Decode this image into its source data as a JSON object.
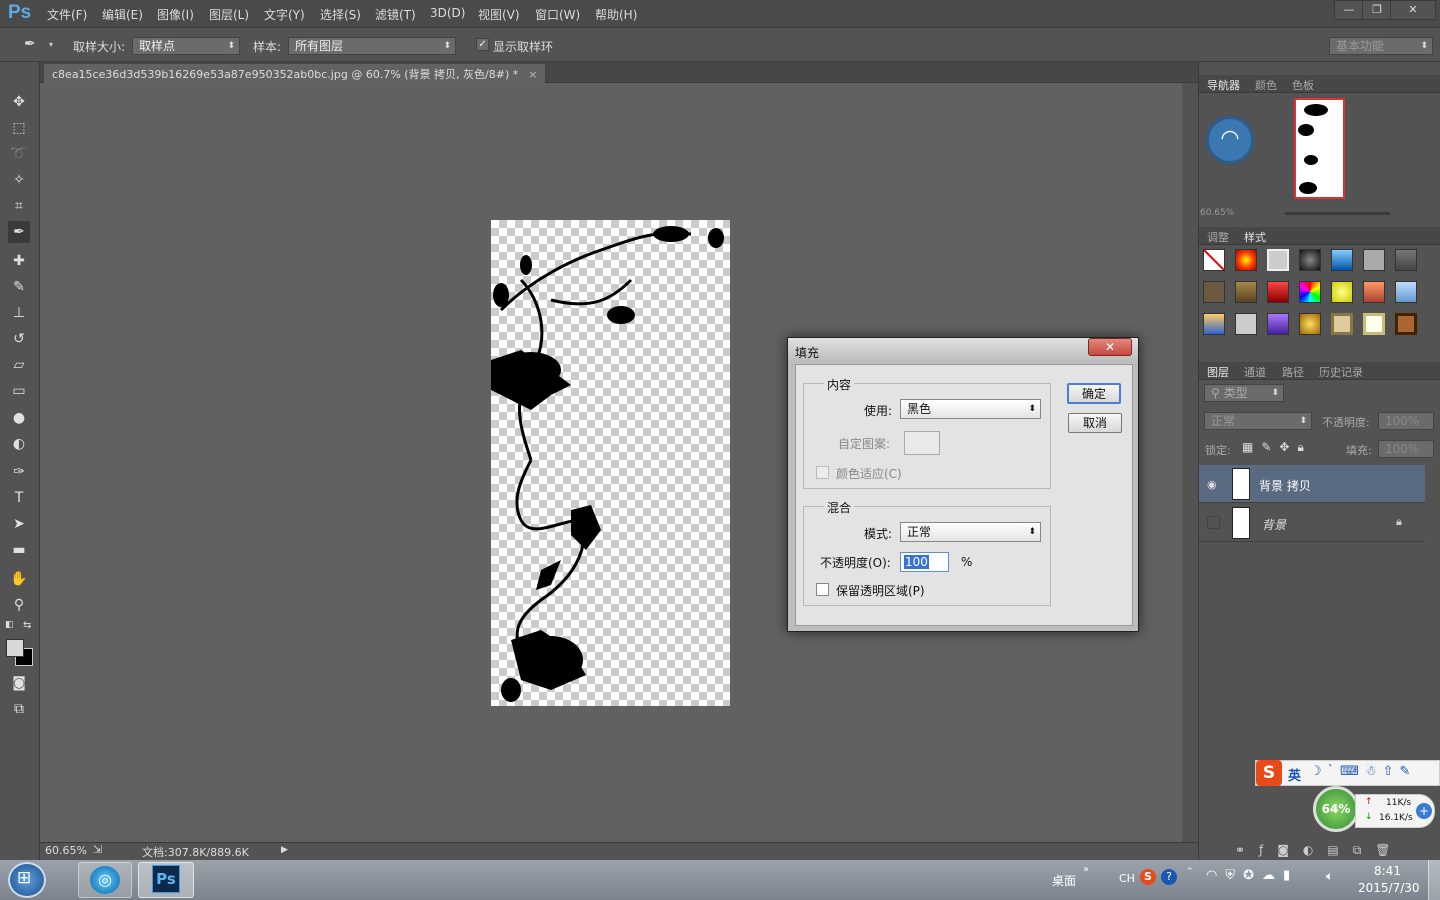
{
  "app": {
    "logo": "Ps"
  },
  "menu": [
    "文件(F)",
    "编辑(E)",
    "图像(I)",
    "图层(L)",
    "文字(Y)",
    "选择(S)",
    "滤镜(T)",
    "3D(D)",
    "视图(V)",
    "窗口(W)",
    "帮助(H)"
  ],
  "options": {
    "sample_size_label": "取样大小:",
    "sample_size_value": "取样点",
    "sample_label": "样本:",
    "sample_value": "所有图层",
    "show_ring_label": "显示取样环",
    "workspace": "基本功能"
  },
  "document": {
    "tab_title": "c8ea15ce36d3d539b16269e53a87e950352ab0bc.jpg @ 60.7% (背景 拷贝, 灰色/8#) *",
    "zoom": "60.65%",
    "doc_info": "文档:307.8K/889.6K"
  },
  "panels": {
    "top_tabs": [
      "导航器",
      "颜色",
      "色板"
    ],
    "nav_zoom": "60.65%",
    "mid_tabs": [
      "调整",
      "样式"
    ],
    "layer_tabs": [
      "图层",
      "通道",
      "路径",
      "历史记录"
    ],
    "filter_type": "类型",
    "blend_mode": "正常",
    "opacity_label": "不透明度:",
    "opacity_value": "100%",
    "lock_label": "锁定:",
    "fill_label": "填充:",
    "fill_value": "100%",
    "layers": [
      {
        "name": "背景 拷贝",
        "visible": true,
        "selected": true
      },
      {
        "name": "背景",
        "visible": false,
        "locked": true
      }
    ]
  },
  "dialog": {
    "title": "填充",
    "content_group": "内容",
    "use_label": "使用:",
    "use_value": "黑色",
    "custom_pattern_label": "自定图案:",
    "color_adapt_label": "颜色适应(C)",
    "blend_group": "混合",
    "mode_label": "模式:",
    "mode_value": "正常",
    "opacity_label": "不透明度(O):",
    "opacity_value": "100",
    "percent": "%",
    "preserve_label": "保留透明区域(P)",
    "ok": "确定",
    "cancel": "取消"
  },
  "ime": {
    "lang": "英"
  },
  "netmon": {
    "percent": "64%",
    "up": "11K/s",
    "down": "16.1K/s"
  },
  "taskbar": {
    "desktop_label": "桌面",
    "lang": "CH",
    "time": "8:41",
    "date": "2015/7/30"
  },
  "colors": {
    "ps_blue": "#5fa8e8",
    "selected_layer": "#5a6a80",
    "dialog_close": "#c9463d"
  }
}
